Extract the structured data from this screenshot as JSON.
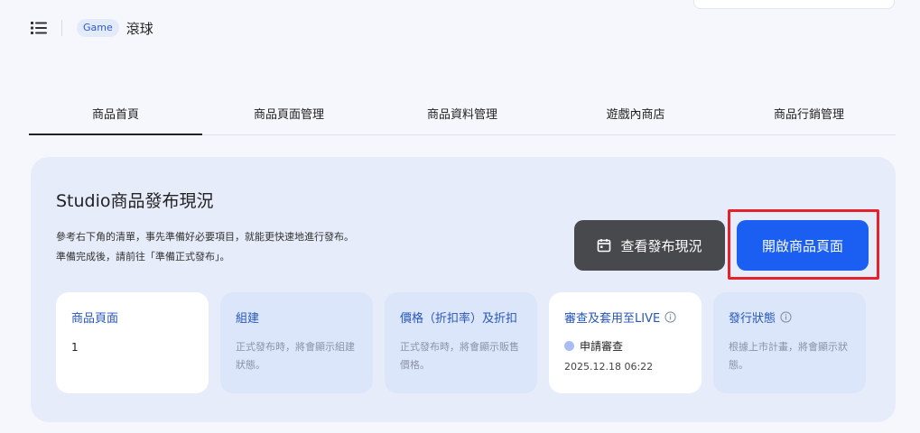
{
  "header": {
    "badge": "Game",
    "title": "滾球"
  },
  "tabs": [
    {
      "label": "商品首頁",
      "active": true
    },
    {
      "label": "商品頁面管理",
      "active": false
    },
    {
      "label": "商品資料管理",
      "active": false
    },
    {
      "label": "遊戲內商店",
      "active": false
    },
    {
      "label": "商品行銷管理",
      "active": false
    }
  ],
  "panel": {
    "title": "Studio商品發布現況",
    "desc_line1": "參考右下角的清單，事先準備好必要項目，就能更快速地進行發布。",
    "desc_line2": "準備完成後，請前往「準備正式發布」。",
    "btn_status": "查看發布現況",
    "btn_open": "開啟商品頁面"
  },
  "cards": [
    {
      "title": "商品頁面",
      "value": "1"
    },
    {
      "title": "組建",
      "desc": "正式發布時，將會顯示組建狀態。"
    },
    {
      "title": "價格（折扣率）及折扣",
      "desc": "正式發布時，將會顯示販售價格。"
    },
    {
      "title": "審查及套用至LIVE",
      "status": "申請審查",
      "date": "2025.12.18 06:22"
    },
    {
      "title": "發行狀態",
      "desc": "根據上市計畫，將會顯示狀態。"
    }
  ],
  "colors": {
    "accent": "#1a5ef2",
    "highlight": "#e8202a",
    "card_title": "#2856b8"
  },
  "icons": [
    "menu-list-icon",
    "calendar-icon",
    "info-icon"
  ]
}
